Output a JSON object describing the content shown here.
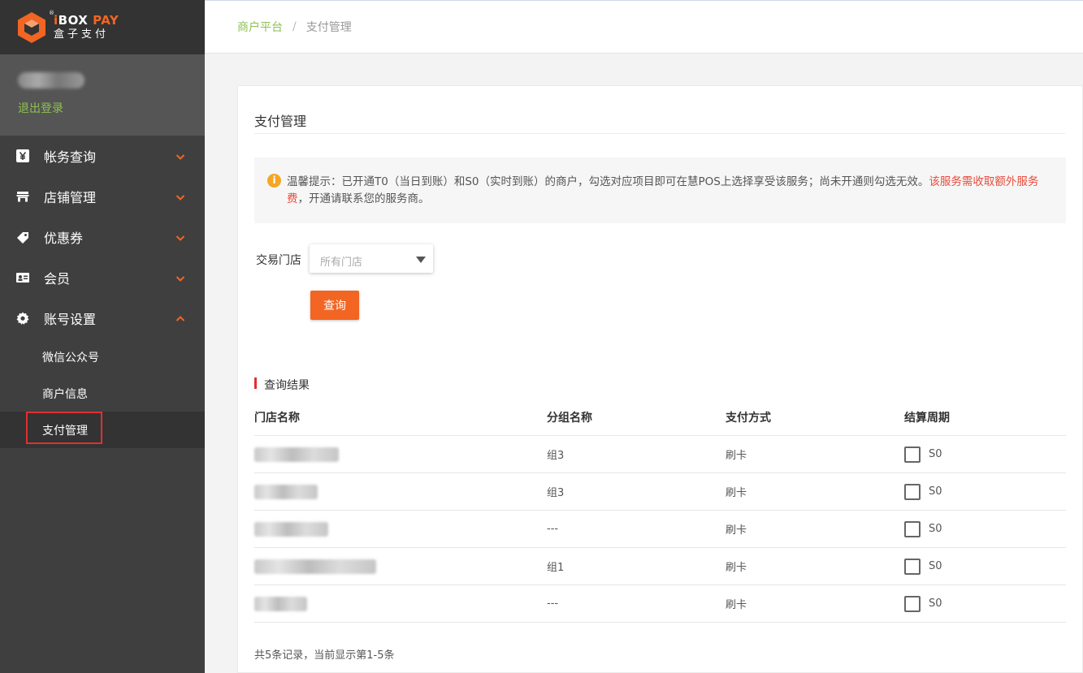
{
  "brand": {
    "logo_en_prefix": "i",
    "logo_en_box": "BOX",
    "logo_en_suffix": " PAY",
    "logo_cn": "盒子支付",
    "reg_mark": "®",
    "accent_color": "#f26522"
  },
  "user": {
    "logout_label": "退出登录"
  },
  "sidebar": {
    "items": [
      {
        "label": "帐务查询",
        "icon": "yen-icon",
        "expanded": false
      },
      {
        "label": "店铺管理",
        "icon": "store-icon",
        "expanded": false
      },
      {
        "label": "优惠券",
        "icon": "coupon-icon",
        "expanded": false
      },
      {
        "label": "会员",
        "icon": "member-card-icon",
        "expanded": false
      },
      {
        "label": "账号设置",
        "icon": "gear-icon",
        "expanded": true
      }
    ],
    "submenu": [
      {
        "label": "微信公众号",
        "active": false
      },
      {
        "label": "商户信息",
        "active": false
      },
      {
        "label": "支付管理",
        "active": true
      }
    ]
  },
  "breadcrumb": {
    "root": "商户平台",
    "separator": "/",
    "current": "支付管理"
  },
  "card": {
    "title": "支付管理",
    "notice": {
      "icon": "info-icon",
      "icon_glyph": "i",
      "text": "温馨提示：已开通T0（当日到账）和S0（实时到账）的商户，勾选对应项目即可在慧POS上选择享受该服务；尚未开通则勾选无效。",
      "highlight": "该服务需收取额外服务费",
      "tail": "，开通请联系您的服务商。"
    },
    "filter": {
      "label": "交易门店",
      "placeholder": "所有门店",
      "button": "查询"
    },
    "results": {
      "title": "查询结果",
      "columns": [
        "门店名称",
        "分组名称",
        "支付方式",
        "结算周期"
      ],
      "rows": [
        {
          "group": "组3",
          "pay_method": "刷卡",
          "settle": "S0",
          "checked": false
        },
        {
          "group": "组3",
          "pay_method": "刷卡",
          "settle": "S0",
          "checked": false
        },
        {
          "group": "---",
          "pay_method": "刷卡",
          "settle": "S0",
          "checked": false
        },
        {
          "group": "组1",
          "pay_method": "刷卡",
          "settle": "S0",
          "checked": false
        },
        {
          "group": "---",
          "pay_method": "刷卡",
          "settle": "S0",
          "checked": false
        }
      ],
      "summary": "共5条记录，当前显示第1-5条"
    }
  }
}
